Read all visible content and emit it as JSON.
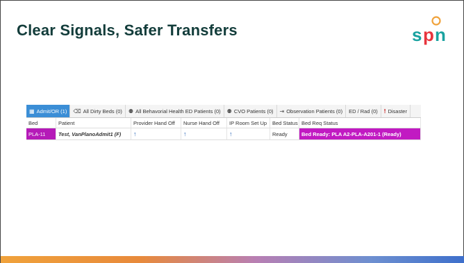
{
  "slide": {
    "title": "Clear Signals, Safer Transfers",
    "logo_text": "spn",
    "colors": {
      "title": "#123c3a",
      "logo_teal": "#1aa2a0",
      "logo_red": "#e8343d",
      "logo_orange": "#f0a23b",
      "tab_active": "#3b8ed6",
      "bed_highlight": "#b51ab8",
      "status_highlight": "#c11ac2"
    }
  },
  "tabs": [
    {
      "label": "Admit/OR (1)",
      "icon": "grid-icon",
      "active": true
    },
    {
      "label": "All Dirty Beds (0)",
      "icon": "broom-icon",
      "active": false
    },
    {
      "label": "All Behavorial Health ED Patients (0)",
      "icon": "people-icon",
      "active": false
    },
    {
      "label": "CVO Patients (0)",
      "icon": "people-icon",
      "active": false
    },
    {
      "label": "Observation Patients (0)",
      "icon": "door-icon",
      "active": false
    },
    {
      "label": "ED / Rad (0)",
      "icon": "",
      "active": false
    },
    {
      "label": "Disaster",
      "icon": "exclamation-icon",
      "active": false
    }
  ],
  "columns": [
    "Bed",
    "Patient",
    "Provider Hand Off",
    "Nurse Hand Off",
    "IP Room Set Up",
    "Bed Status",
    "Bed Req Status"
  ],
  "rows": [
    {
      "bed": "PLA-11",
      "patient": "Test, VanPlanoAdmit1 (F)",
      "provider_hand_off": "↑",
      "nurse_hand_off": "↑",
      "ip_room_set_up": "↑",
      "bed_status": "Ready",
      "bed_req_status": "Bed Ready: PLA A2-PLA-A201-1 (Ready)"
    }
  ]
}
